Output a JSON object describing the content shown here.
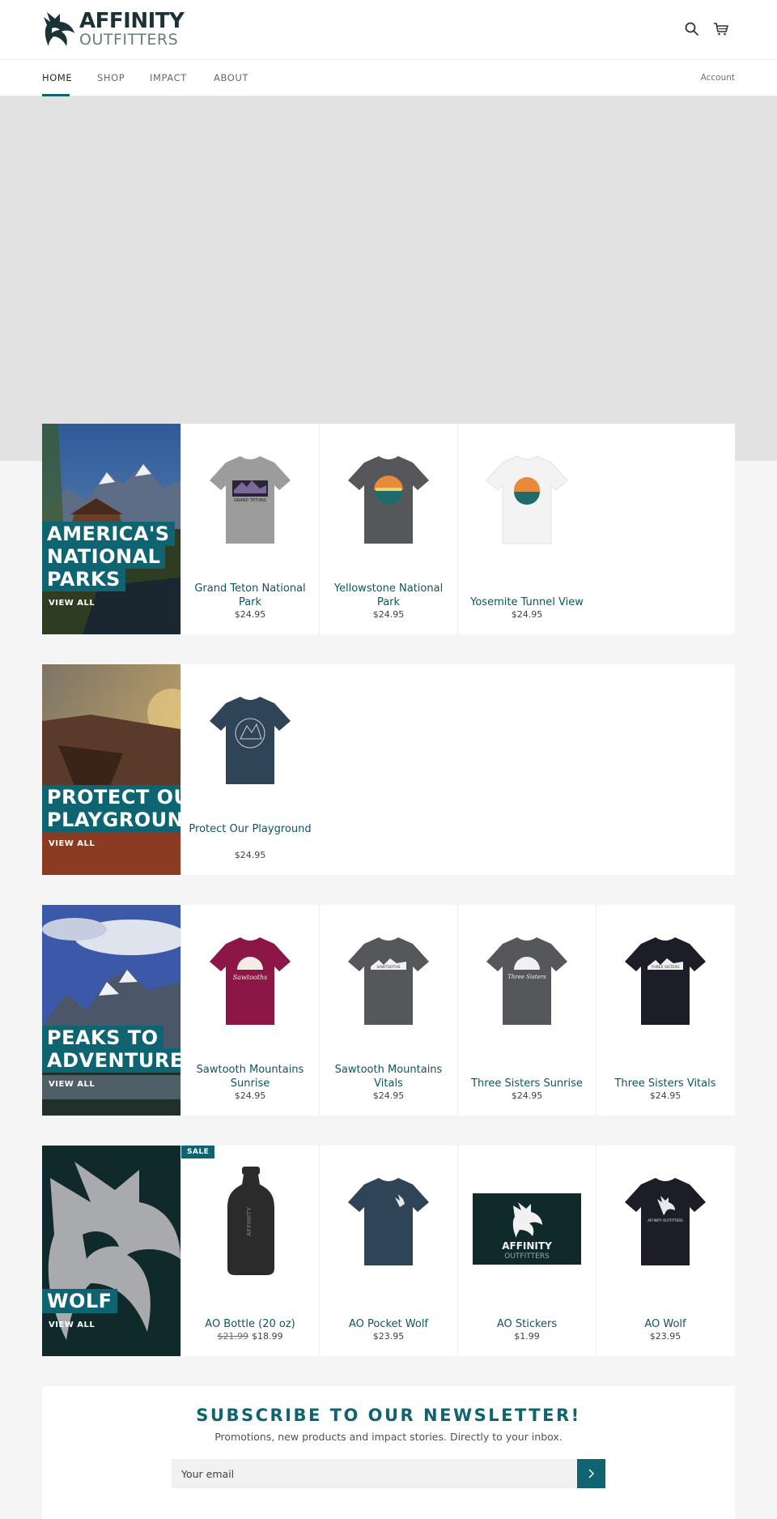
{
  "brand": {
    "name_line1": "AFFINITY",
    "name_line2": "OUTFITTERS"
  },
  "header": {
    "search_icon": "search-icon",
    "cart_icon": "cart-icon"
  },
  "nav": {
    "items": [
      {
        "label": "HOME",
        "active": true
      },
      {
        "label": "SHOP"
      },
      {
        "label": "IMPACT"
      },
      {
        "label": "ABOUT"
      }
    ],
    "account_label": "Account"
  },
  "collections": [
    {
      "title_lines": [
        "AMERICA'S",
        "NATIONAL",
        "PARKS"
      ],
      "view_all": "VIEW ALL",
      "products": [
        {
          "name": "Grand Teton National Park",
          "price": "$24.95",
          "shirt_color": "#9c9c9c",
          "graphic_label": "GRAND TETONS"
        },
        {
          "name": "Yellowstone National Park",
          "price": "$24.95",
          "shirt_color": "#55575a"
        },
        {
          "name": "Yosemite Tunnel View",
          "price": "$24.95",
          "shirt_color": "#f3f3f3"
        }
      ]
    },
    {
      "title_lines": [
        "PROTECT OUR",
        "PLAYGROUND"
      ],
      "view_all": "VIEW ALL",
      "products": [
        {
          "name": "Protect Our Playground",
          "price": "$24.95",
          "shirt_color": "#2f4457"
        }
      ]
    },
    {
      "title_lines": [
        "PEAKS TO",
        "ADVENTURE"
      ],
      "view_all": "VIEW ALL",
      "products": [
        {
          "name": "Sawtooth Mountains Sunrise",
          "price": "$24.95",
          "shirt_color": "#8c1747",
          "graphic_label": "Sawtooths"
        },
        {
          "name": "Sawtooth Mountains Vitals",
          "price": "$24.95",
          "shirt_color": "#55575a",
          "graphic_label": "SAWTOOTHS"
        },
        {
          "name": "Three Sisters Sunrise",
          "price": "$24.95",
          "shirt_color": "#55575a",
          "graphic_label": "Three Sisters"
        },
        {
          "name": "Three Sisters Vitals",
          "price": "$24.95",
          "shirt_color": "#1c1d26",
          "graphic_label": "THREE SISTERS"
        }
      ]
    },
    {
      "title_lines": [
        "WOLF"
      ],
      "view_all": "VIEW ALL",
      "products": [
        {
          "name": "AO Bottle (20 oz)",
          "price": "$18.99",
          "compare_price": "$21.99",
          "badge": "SALE",
          "graphic_label": "AFFINITY"
        },
        {
          "name": "AO Pocket Wolf",
          "price": "$23.95",
          "shirt_color": "#2f4457"
        },
        {
          "name": "AO Stickers",
          "price": "$1.99",
          "sticker_line1": "AFFINITY",
          "sticker_line2": "OUTFITTERS"
        },
        {
          "name": "AO Wolf",
          "price": "$23.95",
          "shirt_color": "#1c1d26",
          "graphic_label": "AFFINITY OUTFITTERS"
        }
      ]
    }
  ],
  "newsletter": {
    "title": "SUBSCRIBE TO OUR NEWSLETTER!",
    "subtitle": "Promotions, new products and impact stories. Directly to your inbox.",
    "email_placeholder": "Your email",
    "submit_icon": "chevron-right-icon"
  },
  "colors": {
    "accent": "#0e6470",
    "dark": "#102a2c"
  }
}
